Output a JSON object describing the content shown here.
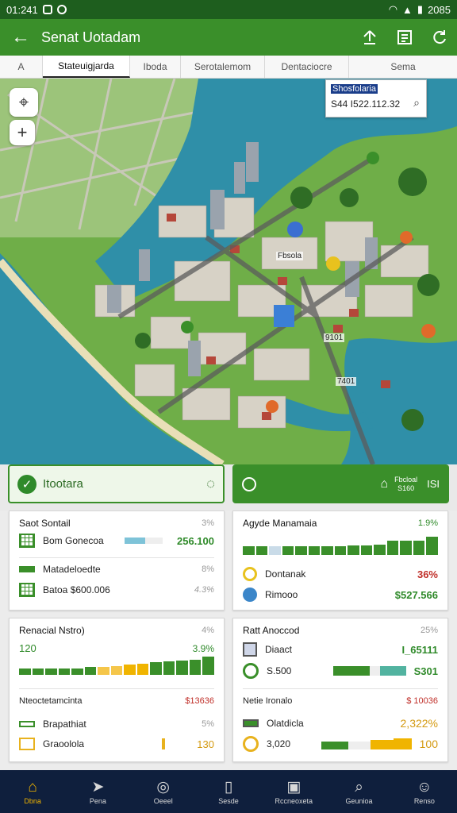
{
  "status": {
    "time": "01:241",
    "right": "2085"
  },
  "appbar": {
    "title": "Senat Uotadam"
  },
  "tabs": [
    "Stateuigjarda",
    "Iboda",
    "Serotalemom",
    "Dentaciocre",
    "Sema"
  ],
  "tab_prefix": "A",
  "map": {
    "search_title": "Shosfolaria",
    "search_value": "S44 I522.112.32",
    "labels": [
      {
        "text": "Fbsola"
      },
      {
        "text": "9101"
      },
      {
        "text": "7401"
      }
    ]
  },
  "summary": {
    "left_label": "Itootara",
    "right_line1": "Fbcloal",
    "right_line2": "S160",
    "right_value": "ISI"
  },
  "cards": {
    "c1": {
      "title": "Saot Sontail",
      "pct": "3%",
      "r1_label": "Bom Gonecoa",
      "r1_value": "256.100",
      "r2_label": "Matadeloedte",
      "r2_pct": "8%",
      "r3_label": "Batoa $600.006",
      "r3_pct": "4.3%"
    },
    "c2": {
      "title": "Agyde Manamaia",
      "pct": "1.9%",
      "r1_label": "Dontanak",
      "r1_value": "36%",
      "r2_label": "Rimooo",
      "r2_value": "$527.566"
    },
    "c3": {
      "title": "Renacial Nstro)",
      "pct": "4%",
      "r1_label": "120",
      "r1_pct": "3.9%",
      "r2_label": "Nteoctetamcinta",
      "r2_value": "$13636",
      "r3_label": "Brapathiat",
      "r3_pct": "5%",
      "r4_label": "Graoolola",
      "r4_value": "130"
    },
    "c4": {
      "title": "Ratt Anoccod",
      "pct": "25%",
      "r1_label": "Diaact",
      "r1_value": "I_65111",
      "r2_label": "S.500",
      "r2_value": "S301",
      "r3_label": "Netie Ironalo",
      "r3_value": "$ 10036",
      "r4_label": "Olatdicla",
      "r4_value": "2,322%",
      "r5_label": "3,020",
      "r5_value": "100"
    }
  },
  "bar_levels": {
    "c2": [
      0.45,
      0.45,
      0.45,
      0.45,
      0.45,
      0.45,
      0.45,
      0.45,
      0.5,
      0.5,
      0.55,
      0.75,
      0.75,
      0.75,
      0.95
    ],
    "c3": [
      0.35,
      0.35,
      0.35,
      0.35,
      0.35,
      0.4,
      0.4,
      0.45,
      0.55,
      0.6,
      0.65,
      0.7,
      0.75,
      0.8,
      0.95
    ]
  },
  "nav": [
    "Dbna",
    "Pena",
    "Oeeel",
    "Sesde",
    "Rccneoxeta",
    "Geunioa",
    "Renso"
  ],
  "colors": {
    "primary": "#3a8f2a",
    "nav": "#0f1f3d",
    "accent": "#f0b400",
    "water": "#2f8fa8"
  }
}
